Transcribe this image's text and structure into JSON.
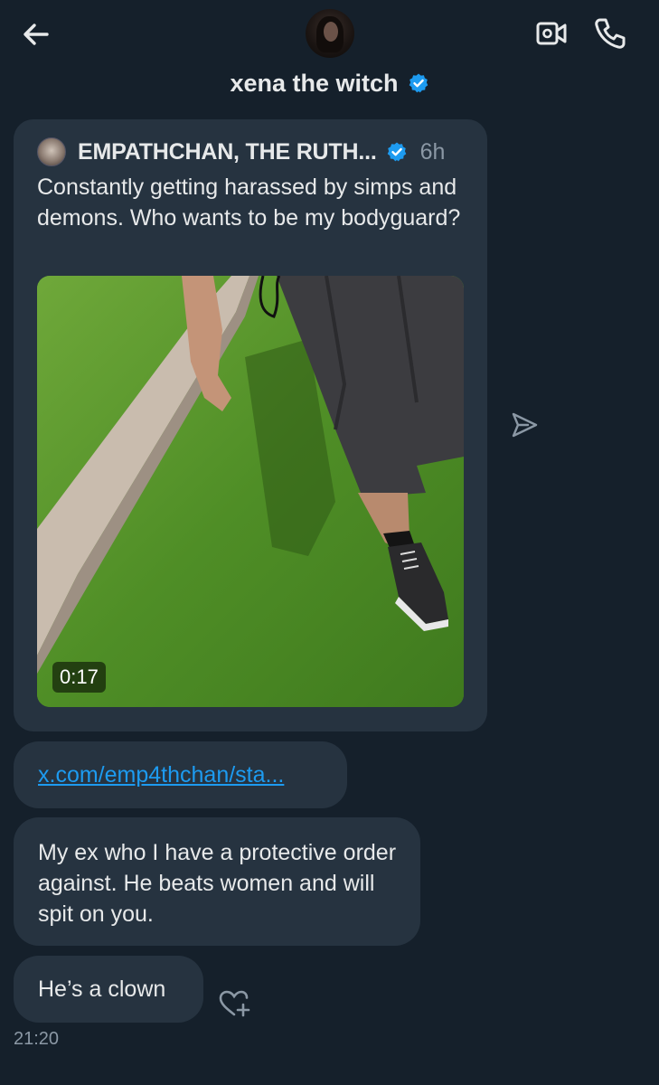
{
  "header": {
    "back_icon": "arrow-left-icon",
    "contact_name": "xena the witch",
    "verified_icon": "verified-badge-icon",
    "video_call_icon": "video-camera-icon",
    "voice_call_icon": "phone-icon"
  },
  "shared_post": {
    "author": "EMPATHCHAN, THE RUTH...",
    "time": "6h",
    "text": "Constantly getting harassed by simps and demons. Who wants to be my bodyguard?",
    "video_duration": "0:17"
  },
  "messages": {
    "link": "x.com/emp4thchan/sta...",
    "message_1": "My ex who I have a protective order against. He beats women and will spit on you.",
    "message_2": "He’s a clown",
    "timestamp": "21:20"
  },
  "colors": {
    "background": "#15202b",
    "bubble": "#263340",
    "link": "#1d9bf0",
    "verified": "#1d9bf0",
    "muted_text": "#8b98a5"
  }
}
